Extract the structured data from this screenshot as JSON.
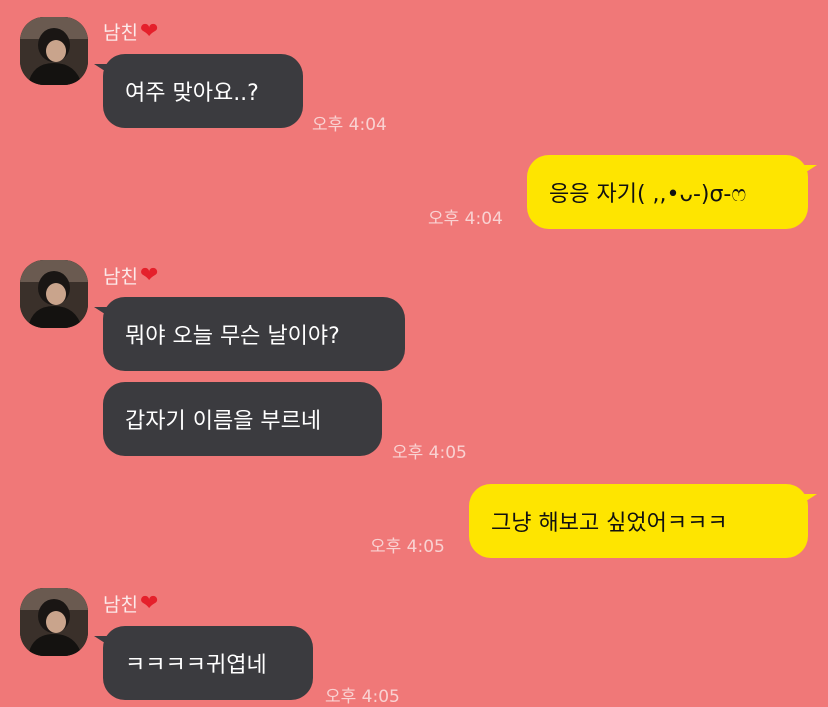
{
  "theme": {
    "background": "#F07878",
    "incoming_bubble": "#3B3B3F",
    "outgoing_bubble": "#FEE500",
    "heart": "#E5202B"
  },
  "messages": [
    {
      "sender": "남친",
      "sender_icon": "red-heart-icon",
      "text": "여주 맞아요..?",
      "time": "오후 4:04"
    },
    {
      "text": "응응 자기( ,,•ᴗ-)σ-ෆ",
      "time": "오후 4:04"
    },
    {
      "sender": "남친",
      "sender_icon": "red-heart-icon",
      "text": "뭐야 오늘 무슨 날이야?"
    },
    {
      "text": "갑자기 이름을 부르네",
      "time": "오후 4:05"
    },
    {
      "text": "그냥 해보고 싶었어ㅋㅋㅋ",
      "time": "오후 4:05"
    },
    {
      "sender": "남친",
      "sender_icon": "red-heart-icon",
      "text": "ㅋㅋㅋㅋ귀엽네",
      "time": "오후 4:05"
    }
  ]
}
